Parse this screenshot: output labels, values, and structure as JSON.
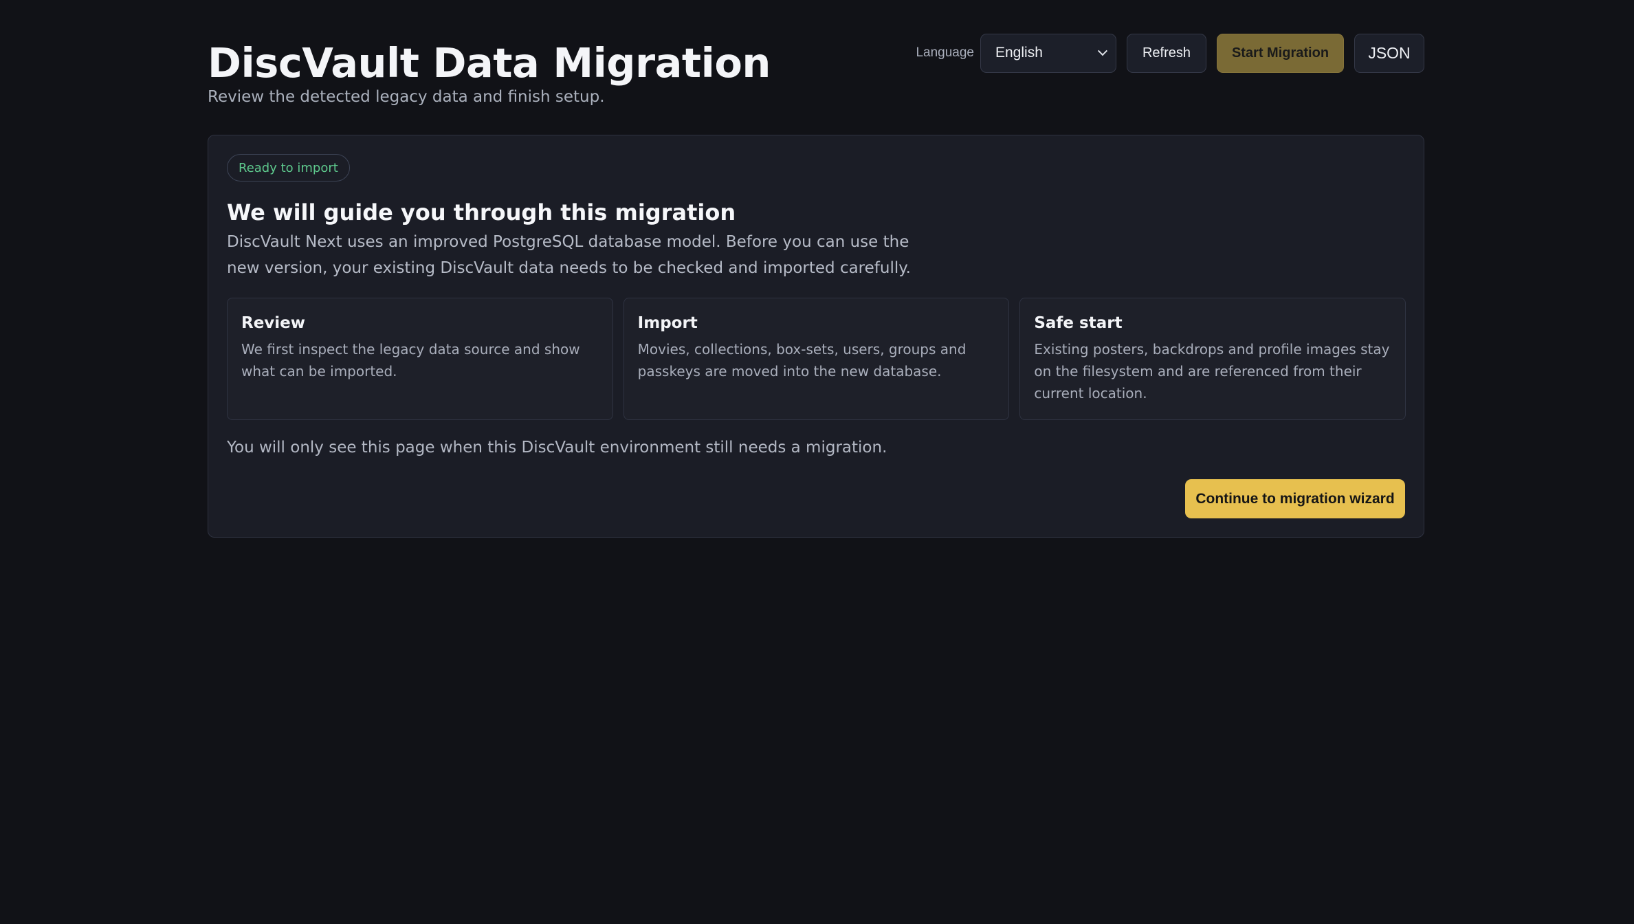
{
  "header": {
    "title": "DiscVault Data Migration",
    "subtitle": "Review the detected legacy data and finish setup."
  },
  "toolbar": {
    "language_label": "Language",
    "language_selected": "English",
    "refresh_label": "Refresh",
    "start_label": "Start Migration",
    "json_label": "JSON"
  },
  "card": {
    "badge": "Ready to import",
    "title": "We will guide you through this migration",
    "intro": "DiscVault Next uses an improved PostgreSQL database model. Before you can use the new version, your existing DiscVault data needs to be checked and imported carefully.",
    "steps": [
      {
        "title": "Review",
        "text": "We first inspect the legacy data source and show what can be imported."
      },
      {
        "title": "Import",
        "text": "Movies, collections, box-sets, users, groups and passkeys are moved into the new database."
      },
      {
        "title": "Safe start",
        "text": "Existing posters, backdrops and profile images stay on the filesystem and are referenced from their current location."
      }
    ],
    "note": "You will only see this page when this DiscVault environment still needs a migration.",
    "continue_label": "Continue to migration wizard"
  },
  "colors": {
    "background": "#111217",
    "accent": "#e7c04f",
    "accent_muted": "#7a6a35",
    "success": "#5ec98d"
  }
}
